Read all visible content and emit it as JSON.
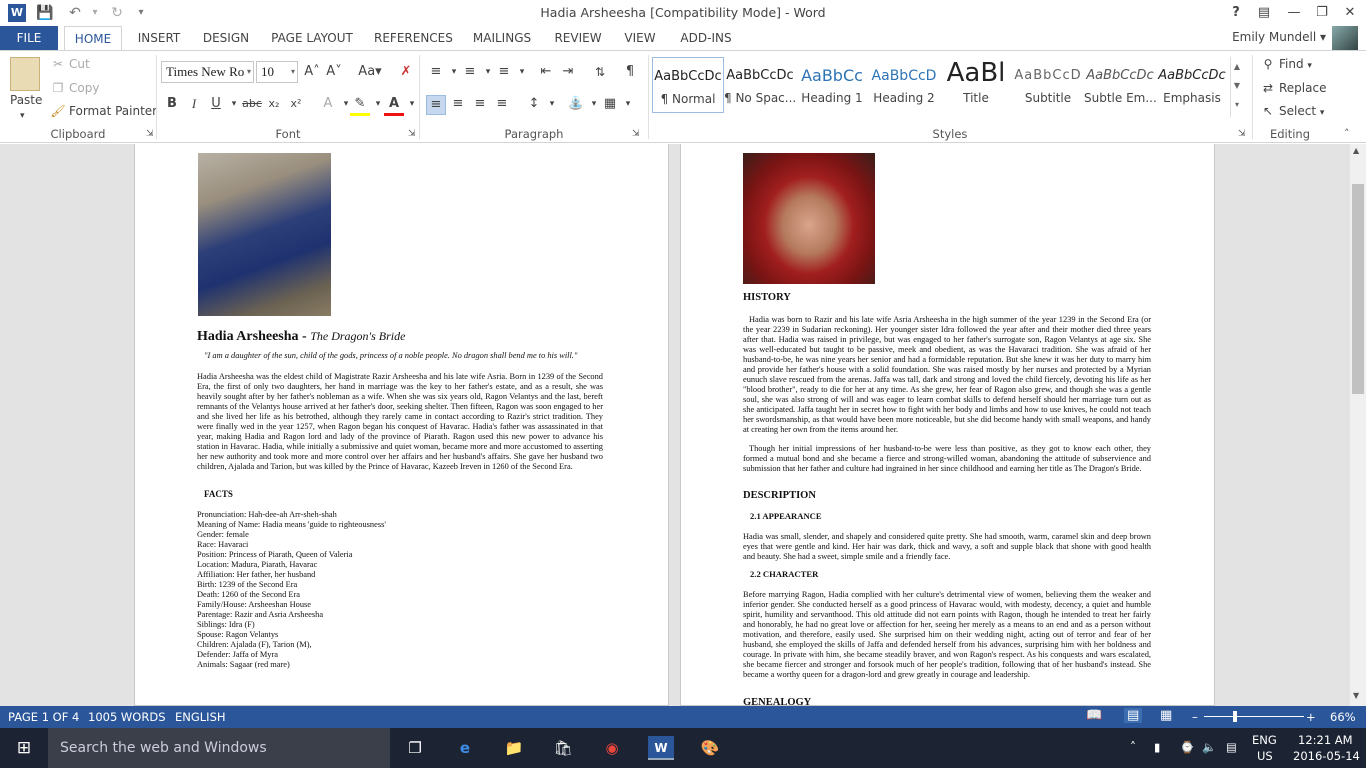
{
  "window": {
    "title": "Hadia Arsheesha [Compatibility Mode] - Word"
  },
  "tabs": [
    "FILE",
    "HOME",
    "INSERT",
    "DESIGN",
    "PAGE LAYOUT",
    "REFERENCES",
    "MAILINGS",
    "REVIEW",
    "VIEW",
    "ADD-INS"
  ],
  "user": {
    "name": "Emily Mundell"
  },
  "ribbon": {
    "clipboard": {
      "paste": "Paste",
      "cut": "Cut",
      "copy": "Copy",
      "format_painter": "Format Painter",
      "label": "Clipboard"
    },
    "font": {
      "name": "Times New Ro",
      "size": "10",
      "label": "Font"
    },
    "paragraph": {
      "label": "Paragraph"
    },
    "styles": {
      "label": "Styles",
      "items": [
        {
          "preview": "AaBbCcDc",
          "name": "¶ Normal"
        },
        {
          "preview": "AaBbCcDc",
          "name": "¶ No Spac..."
        },
        {
          "preview": "AaBbCc",
          "name": "Heading 1"
        },
        {
          "preview": "AaBbCcD",
          "name": "Heading 2"
        },
        {
          "preview": "AaBl",
          "name": "Title"
        },
        {
          "preview": "AaBbCcD",
          "name": "Subtitle"
        },
        {
          "preview": "AaBbCcDc",
          "name": "Subtle Em..."
        },
        {
          "preview": "AaBbCcDc",
          "name": "Emphasis"
        }
      ]
    },
    "editing": {
      "find": "Find",
      "replace": "Replace",
      "select": "Select",
      "label": "Editing"
    }
  },
  "doc": {
    "name": "Hadia Arsheesha",
    "subtitle": "The Dragon's Bride",
    "quote": "\"I am a daughter of the sun, child of the gods, princess of a noble people. No dragon shall bend me to his will.\"",
    "bio": "Hadia Arsheesha was the eldest child of Magistrate Razir Arsheesha and his late wife Asria. Born in 1239 of the Second Era, the first of only two daughters, her hand in marriage was the key to her father's estate, and as a result, she was heavily sought after by her father's nobleman as a wife. When she was six years old, Ragon Velantys and the last, bereft remnants of the Velantys house arrived at her father's door, seeking shelter. Then fifteen, Ragon was soon engaged to her and she lived her life as his betrothed, although they rarely came in contact according to Razir's strict tradition. They were finally wed in the year 1257, when Ragon began his conquest of Havarac. Hadia's father was assassinated in that year, making Hadia and Ragon lord and lady of the province of Piarath. Ragon used this new power to advance his station in Havarac. Hadia, while initially a submissive and quiet woman, became more and more accustomed to asserting her new authority and took more and more control over her affairs and her husband's affairs. She gave her husband two children, Ajalada and Tarion, but was killed by the Prince of Havarac, Kazeeb Ireven in 1260 of the Second Era.",
    "facts_heading": "FACTS",
    "facts": [
      "Pronunciation: Hah-dee-ah   Arr-sheh-shah",
      "Meaning of Name: Hadia means 'guide to righteousness'",
      "Gender: female",
      "Race: Havaraci",
      "Position: Princess of Piarath, Queen of Valeria",
      "Location: Madura, Piarath, Havarac",
      "Affiliation: Her father, her husband",
      "Birth: 1239 of the Second Era",
      "Death: 1260 of the Second Era",
      "Family/House: Arsheeshan House",
      "Parentage: Razir and Asria Arsheesha",
      "Siblings: Idra (F)",
      "Spouse: Ragon Velantys",
      "Children: Ajalada (F), Tarion (M),",
      "Defender: Jaffa of Myra",
      "Animals: Sagaar (red mare)"
    ],
    "history_heading": "HISTORY",
    "history_p1": "Hadia was born to Razir and his late wife Asria Arsheesha in the high summer of the year 1239 in the Second Era (or the year 2239 in Sudarian reckoning). Her younger sister Idra followed the year after and their mother died three years after that. Hadia was raised in privilege, but was engaged to her father's surrogate son, Ragon Velantys at age six. She was well-educated but taught to be passive, meek and obedient, as was the Havaraci tradition. She was afraid of her husband-to-be, he was nine years her senior and had a formidable reputation. But she knew it was her duty to marry him and provide her father's house with a solid foundation. She was raised mostly by her nurses and protected by a Myrian eunuch slave rescued from the arenas. Jaffa was tall, dark and strong and loved the child fiercely, devoting his life as her \"blood brother\", ready to die for her at any time. As she grew, her fear of Ragon also grew, and though she was a gentle soul, she was also strong of will and was eager to learn combat skills to defend herself should her marriage turn out as she anticipated. Jaffa taught her in secret how to fight with her body and limbs and how to use knives, he could not teach her swordsmanship, as that would have been more noticeable, but she did become handy with small weapons, and handy at creating her own from the items around her.",
    "history_p2": "Though her initial impressions of her husband-to-be were less than positive, as they got to know each other, they formed a mutual bond and she became a fierce and strong-willed woman, abandoning the attitude of subservience and submission that her father and culture had ingrained in her since childhood and earning her title as The Dragon's Bride.",
    "description_heading": "DESCRIPTION",
    "appearance_heading": "2.1 APPEARANCE",
    "appearance": "Hadia was small, slender, and shapely and considered quite pretty. She had smooth, warm, caramel skin and deep brown eyes that were gentle and kind. Her hair was dark, thick and wavy, a soft and supple black that shone with good health and beauty. She had a sweet, simple smile and a friendly face.",
    "character_heading": "2.2 CHARACTER",
    "character": "Before marrying Ragon, Hadia complied with her culture's detrimental view of women, believing them the weaker and inferior gender. She conducted herself as a good princess of Havarac would, with modesty, decency, a quiet and humble spirit, humility and servanthood. This old attitude did not earn points with Ragon, though he intended to treat her fairly and honorably, he had no great love or affection for her, seeing her merely as a means to an end and as a person without motivation, and therefore, easily used. She surprised him on their wedding night, acting out of terror and fear of her husband, she employed the skills of Jaffa and defended herself from his advances, surprising him with her boldness and courage. In private with him, she became steadily braver, and won Ragon's respect. As his conquests and wars escalated, she became fiercer and stronger and forsook much of her people's tradition, following that of her husband's instead. She became a worthy queen for a dragon-lord and grew greatly in courage and leadership.",
    "genealogy_heading": "GENEALOGY"
  },
  "status": {
    "page": "PAGE 1 OF 4",
    "words": "1005 WORDS",
    "lang": "ENGLISH",
    "zoom": "66%"
  },
  "taskbar": {
    "search": "Search the web and Windows",
    "lang1": "ENG",
    "lang2": "US",
    "time": "12:21 AM",
    "date": "2016-05-14"
  }
}
